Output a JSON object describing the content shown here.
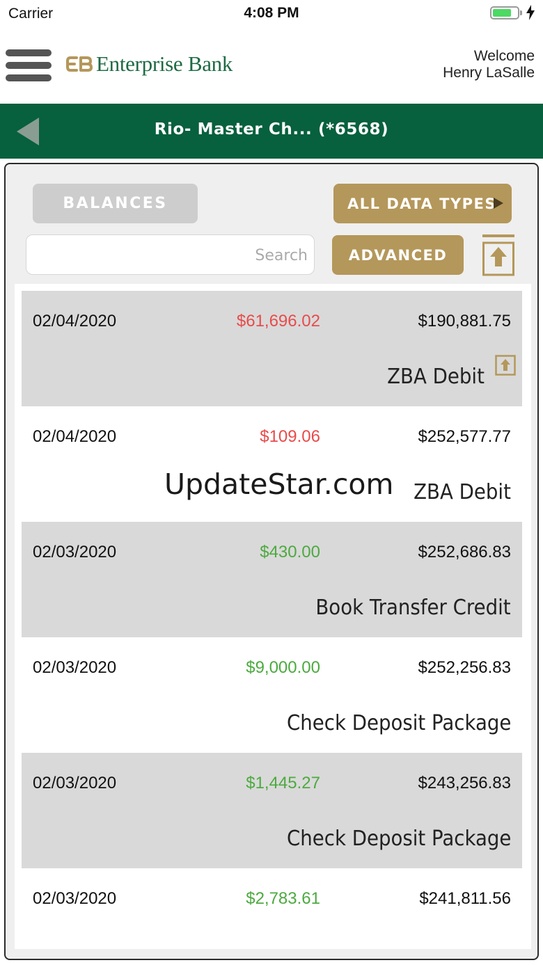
{
  "status_bar": {
    "carrier": "Carrier",
    "time": "4:08 PM",
    "battery_color": "#4cd964"
  },
  "header": {
    "brand": "Enterprise Bank",
    "brand_color": "#1e6a43",
    "logo_accent": "#b4975a",
    "welcome_label": "Welcome",
    "user_name": "Henry LaSalle"
  },
  "title_bar": {
    "title": "Rio- Master Ch...  (*6568)",
    "background": "#07603e"
  },
  "toolbar": {
    "balances_label": "BALANCES",
    "all_types_label": "ALL DATA TYPES",
    "advanced_label": "ADVANCED",
    "search_placeholder": "Search",
    "search_value": ""
  },
  "transactions": [
    {
      "date": "02/04/2020",
      "amount": "$61,696.02",
      "direction": "debit",
      "balance": "$190,881.75",
      "description": "ZBA Debit",
      "has_icon": true
    },
    {
      "date": "02/04/2020",
      "amount": "$109.06",
      "direction": "debit",
      "balance": "$252,577.77",
      "description": "ZBA Debit",
      "has_icon": false
    },
    {
      "date": "02/03/2020",
      "amount": "$430.00",
      "direction": "credit",
      "balance": "$252,686.83",
      "description": "Book Transfer Credit",
      "has_icon": false
    },
    {
      "date": "02/03/2020",
      "amount": "$9,000.00",
      "direction": "credit",
      "balance": "$252,256.83",
      "description": "Check Deposit Package",
      "has_icon": false
    },
    {
      "date": "02/03/2020",
      "amount": "$1,445.27",
      "direction": "credit",
      "balance": "$243,256.83",
      "description": "Check Deposit Package",
      "has_icon": false
    },
    {
      "date": "02/03/2020",
      "amount": "$2,783.61",
      "direction": "credit",
      "balance": "$241,811.56",
      "description": "",
      "has_icon": false
    }
  ],
  "colors": {
    "debit": "#e84b4b",
    "credit": "#4caa3f",
    "gold": "#b4975a"
  },
  "watermark": "UpdateStar.com"
}
